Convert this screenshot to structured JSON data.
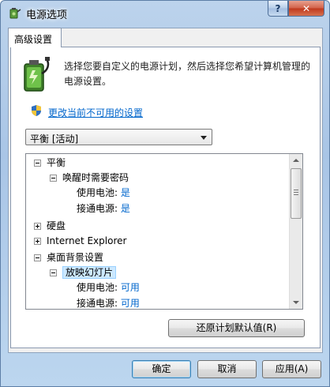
{
  "window": {
    "title": "电源选项",
    "help_label": "?",
    "close_label": "✕"
  },
  "tab": {
    "label": "高级设置"
  },
  "description": "选择您要自定义的电源计划，然后选择您希望计算机管理的电源设置。",
  "change_link": "更改当前不可用的设置",
  "plan_select": {
    "value": "平衡 [活动]"
  },
  "tree": {
    "rows": [
      {
        "label": "平衡"
      },
      {
        "label": "唤醒时需要密码"
      },
      {
        "label": "使用电池:",
        "value": "是"
      },
      {
        "label": "接通电源:",
        "value": "是"
      },
      {
        "label": "硬盘"
      },
      {
        "label": "Internet Explorer"
      },
      {
        "label": "桌面背景设置"
      },
      {
        "label": "放映幻灯片"
      },
      {
        "label": "使用电池:",
        "value": "可用"
      },
      {
        "label": "接通电源:",
        "value": "可用"
      }
    ]
  },
  "buttons": {
    "restore": "还原计划默认值(R)",
    "ok": "确定",
    "cancel": "取消",
    "apply": "应用(A)"
  },
  "colors": {
    "link": "#0066cc",
    "selection": "#cce8ff"
  }
}
